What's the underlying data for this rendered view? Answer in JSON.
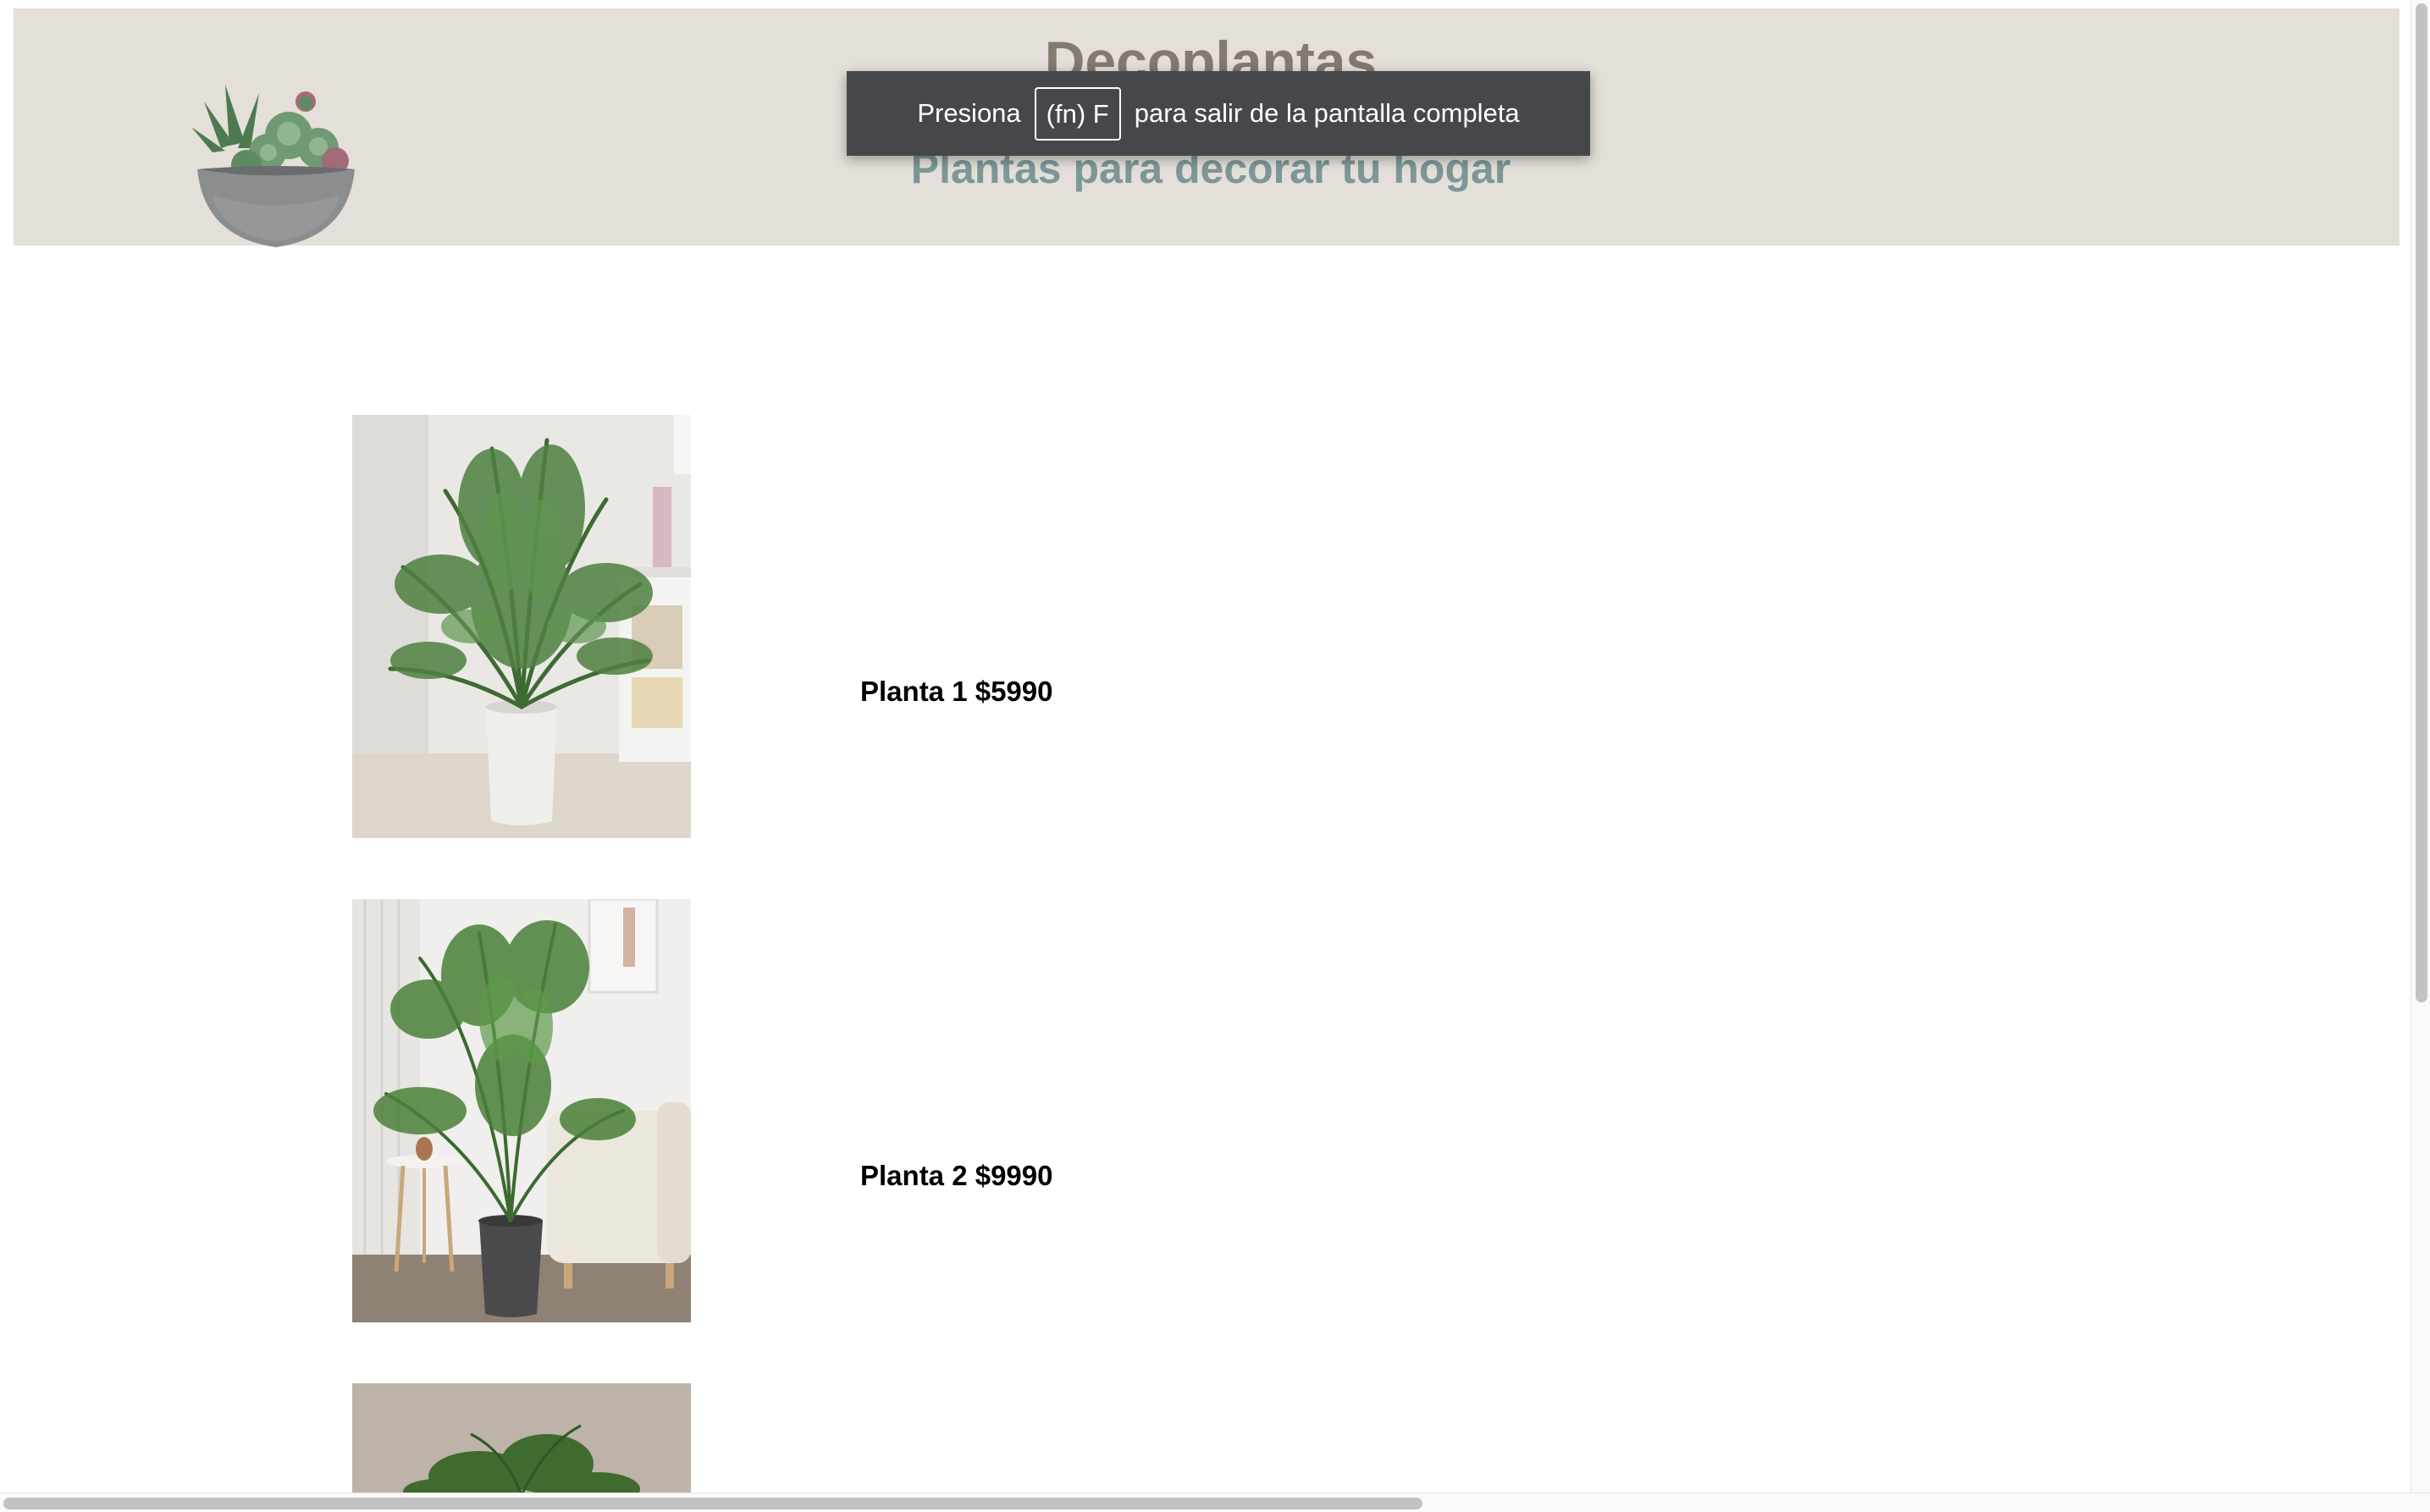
{
  "header": {
    "title": "Decoplantas",
    "subtitle": "Plantas para decorar tu hogar",
    "logo_icon": "succulent-bowl-icon",
    "background_color": "#e4dfd9",
    "title_color": "#837a70",
    "subtitle_color": "#7d9799"
  },
  "fullscreen_notice": {
    "prefix": "Presiona",
    "key": "(fn) F",
    "suffix": "para salir de la pantalla completa"
  },
  "products": [
    {
      "label": "Planta 1 $5990",
      "image_icon": "areca-palm-photo"
    },
    {
      "label": "Planta 2 $9990",
      "image_icon": "kentia-palm-photo"
    },
    {
      "label": "",
      "image_icon": "palm-photo-partial"
    }
  ]
}
